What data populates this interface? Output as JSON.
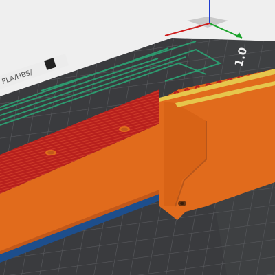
{
  "app": {
    "title": ""
  },
  "bed": {
    "label_text": "PLA/HBS/",
    "logo_text": "1.0",
    "colors": {
      "background": "#efefef",
      "plate": "#3a3b3e",
      "grid": "#5a5b5f",
      "toolpath_green": "#2d9a6f",
      "part_orange": "#e16b1c",
      "part_orange_dark": "#c2581a",
      "infill_red": "#b8201d",
      "infill_line": "#cf3b2a",
      "top_yellow": "#e6c64c",
      "base_blue": "#1d4e8c"
    }
  },
  "axes": {
    "x_color": "#d01e1e",
    "y_color": "#1aa32a",
    "z_color": "#1e3cd0"
  },
  "icons": {
    "axis_gizmo": "axis-gizmo-icon",
    "print_hole": "mounting-hole-icon"
  }
}
